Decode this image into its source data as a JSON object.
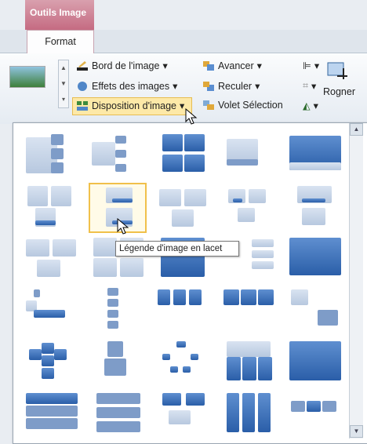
{
  "context_tab": {
    "title": "Outils Image"
  },
  "tabs": {
    "active": "Format"
  },
  "ribbon": {
    "bord": "Bord de l'image",
    "effets": "Effets des images",
    "disposition": "Disposition d'image",
    "avancer": "Avancer",
    "reculer": "Reculer",
    "volet": "Volet Sélection",
    "rogner": "Rogner"
  },
  "gallery": {
    "tooltip": "Légende d'image en lacet",
    "selected_index": 6,
    "layouts": [
      "layout-1",
      "layout-2",
      "layout-3",
      "layout-4",
      "layout-5",
      "layout-6",
      "layout-7",
      "layout-8",
      "layout-9",
      "layout-10",
      "layout-11",
      "layout-12",
      "layout-13",
      "layout-14",
      "layout-15",
      "layout-16",
      "layout-17",
      "layout-18",
      "layout-19",
      "layout-20",
      "layout-21",
      "layout-22",
      "layout-23",
      "layout-24",
      "layout-25",
      "layout-26",
      "layout-27",
      "layout-28",
      "layout-29",
      "layout-30"
    ]
  },
  "colors": {
    "accent": "#2a5ea8",
    "light": "#c9d6e8",
    "ctx": "#c56b82",
    "highlight": "#fde9a8"
  }
}
